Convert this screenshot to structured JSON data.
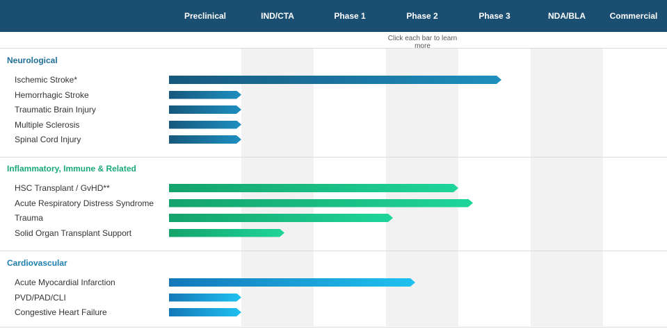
{
  "header": {
    "stages": [
      "Preclinical",
      "IND/CTA",
      "Phase 1",
      "Phase 2",
      "Phase 3",
      "NDA/BLA",
      "Commercial"
    ],
    "hint": "Click each bar to learn more"
  },
  "colors": {
    "header": "#1b4f72",
    "neurological_title": "#1f6f99",
    "inflammatory_title": "#1aa978",
    "cardiovascular_title": "#1f7fae"
  },
  "chart_data": {
    "type": "bar",
    "orientation": "horizontal",
    "value_scale": "development stage (1 = Preclinical ... 7 = Commercial); value = stage progress reached",
    "stages": [
      "Preclinical",
      "IND/CTA",
      "Phase 1",
      "Phase 2",
      "Phase 3",
      "NDA/BLA",
      "Commercial"
    ],
    "sections": [
      {
        "title": "Neurological",
        "style": "neuro",
        "rows": [
          {
            "label": "Ischemic Stroke*",
            "value": 4.6
          },
          {
            "label": "Hemorrhagic Stroke",
            "value": 1.0
          },
          {
            "label": "Traumatic Brain Injury",
            "value": 1.0
          },
          {
            "label": "Multiple Sclerosis",
            "value": 1.0
          },
          {
            "label": "Spinal Cord Injury",
            "value": 1.0
          }
        ]
      },
      {
        "title": "Inflammatory, Immune & Related",
        "style": "inflam",
        "rows": [
          {
            "label": "HSC Transplant / GvHD**",
            "value": 4.0
          },
          {
            "label": "Acute Respiratory Distress Syndrome",
            "value": 4.2
          },
          {
            "label": "Trauma",
            "value": 3.1
          },
          {
            "label": "Solid Organ Transplant Support",
            "value": 1.6
          }
        ]
      },
      {
        "title": "Cardiovascular",
        "style": "cardio",
        "rows": [
          {
            "label": "Acute Myocardial Infarction",
            "value": 3.4
          },
          {
            "label": "PVD/PAD/CLI",
            "value": 1.0
          },
          {
            "label": "Congestive Heart Failure",
            "value": 1.0
          }
        ]
      }
    ]
  }
}
